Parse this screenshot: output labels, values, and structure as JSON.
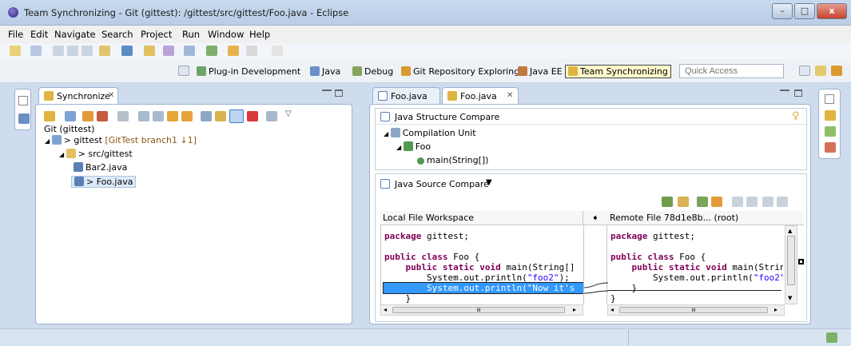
{
  "window": {
    "title": "Team Synchronizing - Git (gittest): /gittest/src/gittest/Foo.java - Eclipse",
    "minimize_label": "–",
    "maximize_label": "□",
    "close_label": "x"
  },
  "menu": [
    "File",
    "Edit",
    "Navigate",
    "Search",
    "Project",
    "Run",
    "Window",
    "Help"
  ],
  "perspectives": [
    {
      "label": "Plug-in Development",
      "icon": "plugin-icon"
    },
    {
      "label": "Java",
      "icon": "java-icon"
    },
    {
      "label": "Debug",
      "icon": "bug-icon"
    },
    {
      "label": "Git Repository Exploring",
      "icon": "git-icon"
    },
    {
      "label": "Java EE",
      "icon": "javaee-icon"
    },
    {
      "label": "Team Synchronizing",
      "icon": "sync-icon",
      "active": true
    }
  ],
  "quick_access": {
    "placeholder": "Quick Access"
  },
  "sync_view": {
    "tab_label": "Synchronize",
    "tab_close": "✕",
    "root_label": "Git (gittest)",
    "tree": [
      {
        "indent": 0,
        "label": "> gittest",
        "decoration": "[GitTest branch1 ↓1]",
        "icon": "project-icon"
      },
      {
        "indent": 1,
        "label": "> src/gittest",
        "decoration": "",
        "icon": "package-icon"
      },
      {
        "indent": 2,
        "label": "Bar2.java",
        "decoration": "",
        "icon": "java-file-icon"
      },
      {
        "indent": 2,
        "label": "> Foo.java",
        "decoration": "",
        "icon": "java-file-icon",
        "selected": true
      }
    ]
  },
  "editor": {
    "tabs": [
      {
        "label": "Foo.java",
        "active": false
      },
      {
        "label": "Foo.java",
        "active": true,
        "close": "✕"
      }
    ],
    "structure_compare": {
      "title": "Java Structure Compare",
      "tree": [
        {
          "indent": 0,
          "label": "Compilation Unit",
          "icon": "compilation-unit-icon"
        },
        {
          "indent": 1,
          "label": "Foo",
          "icon": "class-icon"
        },
        {
          "indent": 2,
          "label": "main(String[])",
          "icon": "method-icon"
        }
      ]
    },
    "source_compare": {
      "title": "Java Source Compare",
      "left_header": "Local File Workspace",
      "right_header": "Remote File 78d1e8b... (root)",
      "left_lines": [
        [
          {
            "t": "package",
            "k": "kw"
          },
          {
            "t": " gittest;",
            "k": ""
          }
        ],
        [],
        [
          {
            "t": "public",
            "k": "kw"
          },
          {
            "t": " ",
            "k": ""
          },
          {
            "t": "class",
            "k": "kw"
          },
          {
            "t": " Foo {",
            "k": ""
          }
        ],
        [
          {
            "t": "    ",
            "k": ""
          },
          {
            "t": "public",
            "k": "kw"
          },
          {
            "t": " ",
            "k": ""
          },
          {
            "t": "static",
            "k": "kw"
          },
          {
            "t": " ",
            "k": ""
          },
          {
            "t": "void",
            "k": "kw"
          },
          {
            "t": " main(String[]",
            "k": ""
          }
        ],
        [
          {
            "t": "        System.out.println(",
            "k": ""
          },
          {
            "t": "\"foo2\"",
            "k": "str"
          },
          {
            "t": ");",
            "k": ""
          }
        ],
        [
          {
            "t": "        System.out.println(\"Now it's",
            "k": ""
          }
        ],
        [
          {
            "t": "    }",
            "k": ""
          }
        ]
      ],
      "right_lines": [
        [
          {
            "t": "package",
            "k": "kw"
          },
          {
            "t": " gittest;",
            "k": ""
          }
        ],
        [],
        [
          {
            "t": "public",
            "k": "kw"
          },
          {
            "t": " ",
            "k": ""
          },
          {
            "t": "class",
            "k": "kw"
          },
          {
            "t": " Foo {",
            "k": ""
          }
        ],
        [
          {
            "t": "    ",
            "k": ""
          },
          {
            "t": "public",
            "k": "kw"
          },
          {
            "t": " ",
            "k": ""
          },
          {
            "t": "static",
            "k": "kw"
          },
          {
            "t": " ",
            "k": ""
          },
          {
            "t": "void",
            "k": "kw"
          },
          {
            "t": " main(Strin",
            "k": ""
          }
        ],
        [
          {
            "t": "        System.out.println(",
            "k": ""
          },
          {
            "t": "\"foo2\"",
            "k": "str"
          }
        ],
        [
          {
            "t": "    }",
            "k": ""
          }
        ],
        [
          {
            "t": "}",
            "k": ""
          }
        ]
      ],
      "scroll_glyph": "III"
    }
  },
  "colors": {
    "diff_highlight": "#3399ff",
    "keyword": "#7f0055",
    "string": "#2a00ff",
    "decoration": "#8b5a14"
  }
}
